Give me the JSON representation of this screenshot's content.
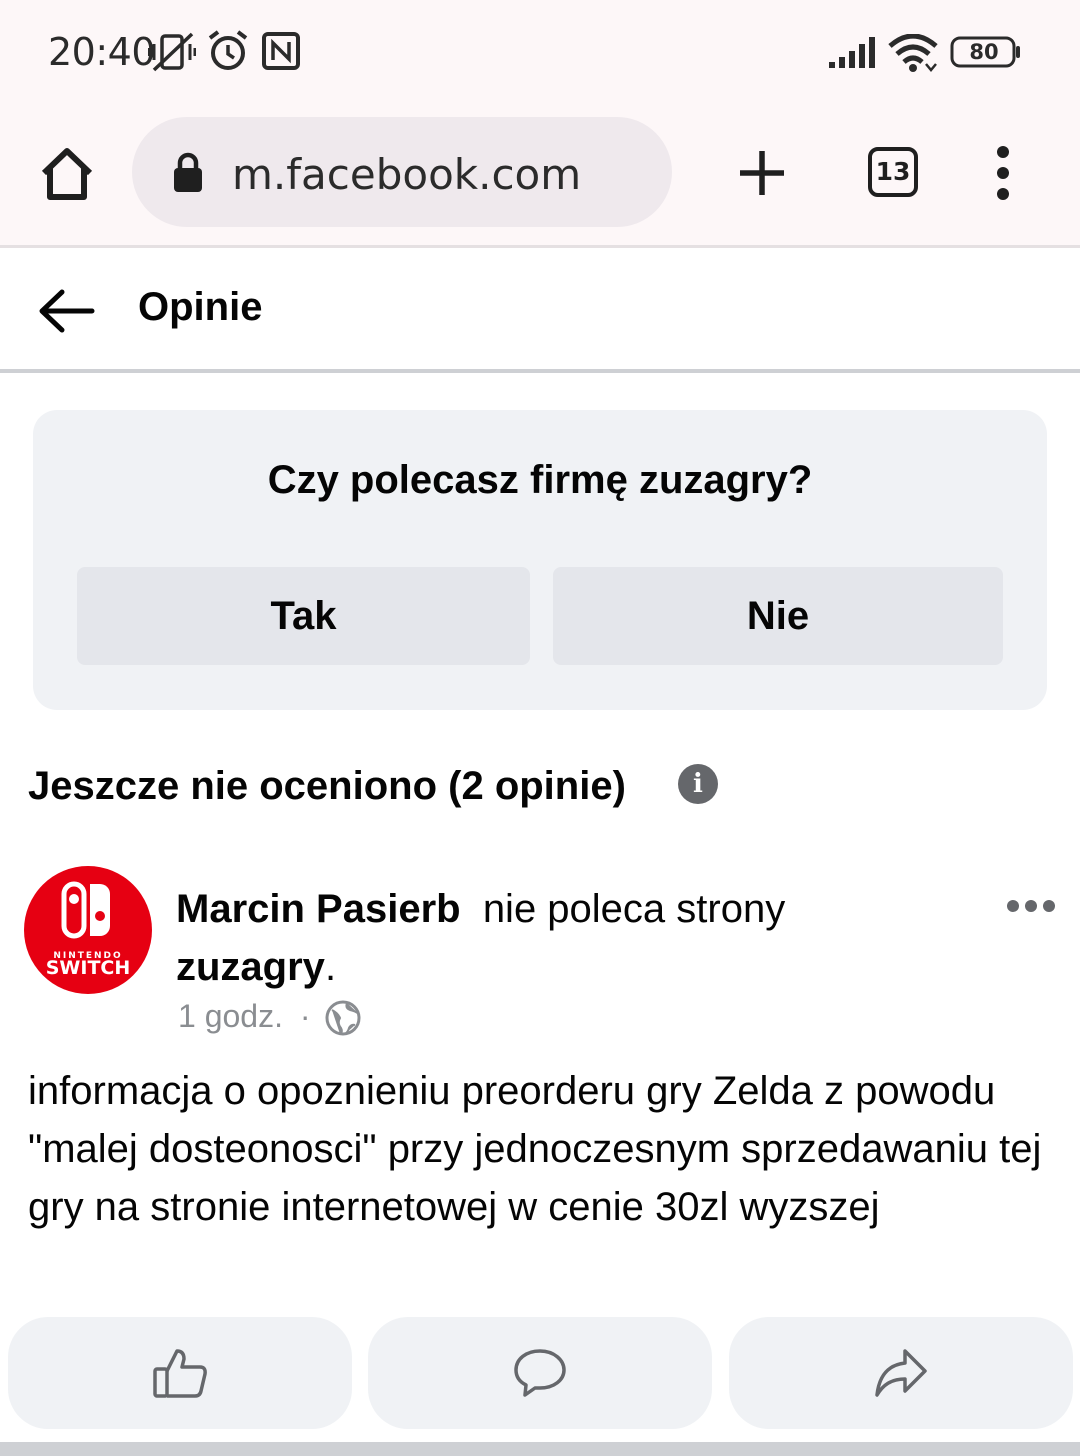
{
  "status_bar": {
    "time": "20:40",
    "battery": "80",
    "icons": [
      "vibrate-off-icon",
      "alarm-icon",
      "nfc-icon",
      "signal-icon",
      "wifi-icon",
      "battery-icon"
    ]
  },
  "browser": {
    "url": "m.facebook.com",
    "tab_count": "13",
    "icons": [
      "home-icon",
      "lock-icon",
      "plus-icon",
      "tabs-icon",
      "more-vertical-icon"
    ]
  },
  "header": {
    "title": "Opinie",
    "icons": [
      "back-arrow-icon"
    ]
  },
  "recommend_card": {
    "question": "Czy polecasz firmę zuzagry?",
    "yes_label": "Tak",
    "no_label": "Nie"
  },
  "reviews_section": {
    "title": "Jeszcze nie oceniono (2 opinie)",
    "icons": [
      "info-icon"
    ]
  },
  "review": {
    "author": "Marcin Pasierb",
    "action": "nie poleca strony",
    "page": "zuzagry",
    "punct": ".",
    "time": "1 godz.",
    "separator": "·",
    "avatar_text_top": "NINTENDO",
    "avatar_text_bottom": "SWITCH",
    "text": "informacja o opoznieniu preorderu gry Zelda z powodu \"malej dosteonosci\" przy jednoczesnym sprzedawaniu tej gry na stronie internetowej w cenie 30zl wyzszej"
  },
  "actions": {
    "icons": [
      "like-icon",
      "comment-icon",
      "share-icon"
    ]
  },
  "colors": {
    "card_bg": "#f0f2f5",
    "button_bg": "#e4e6eb",
    "avatar_red": "#e60012",
    "secondary_text": "#8a8d91",
    "browser_bar_bg": "#fdf7f8"
  }
}
